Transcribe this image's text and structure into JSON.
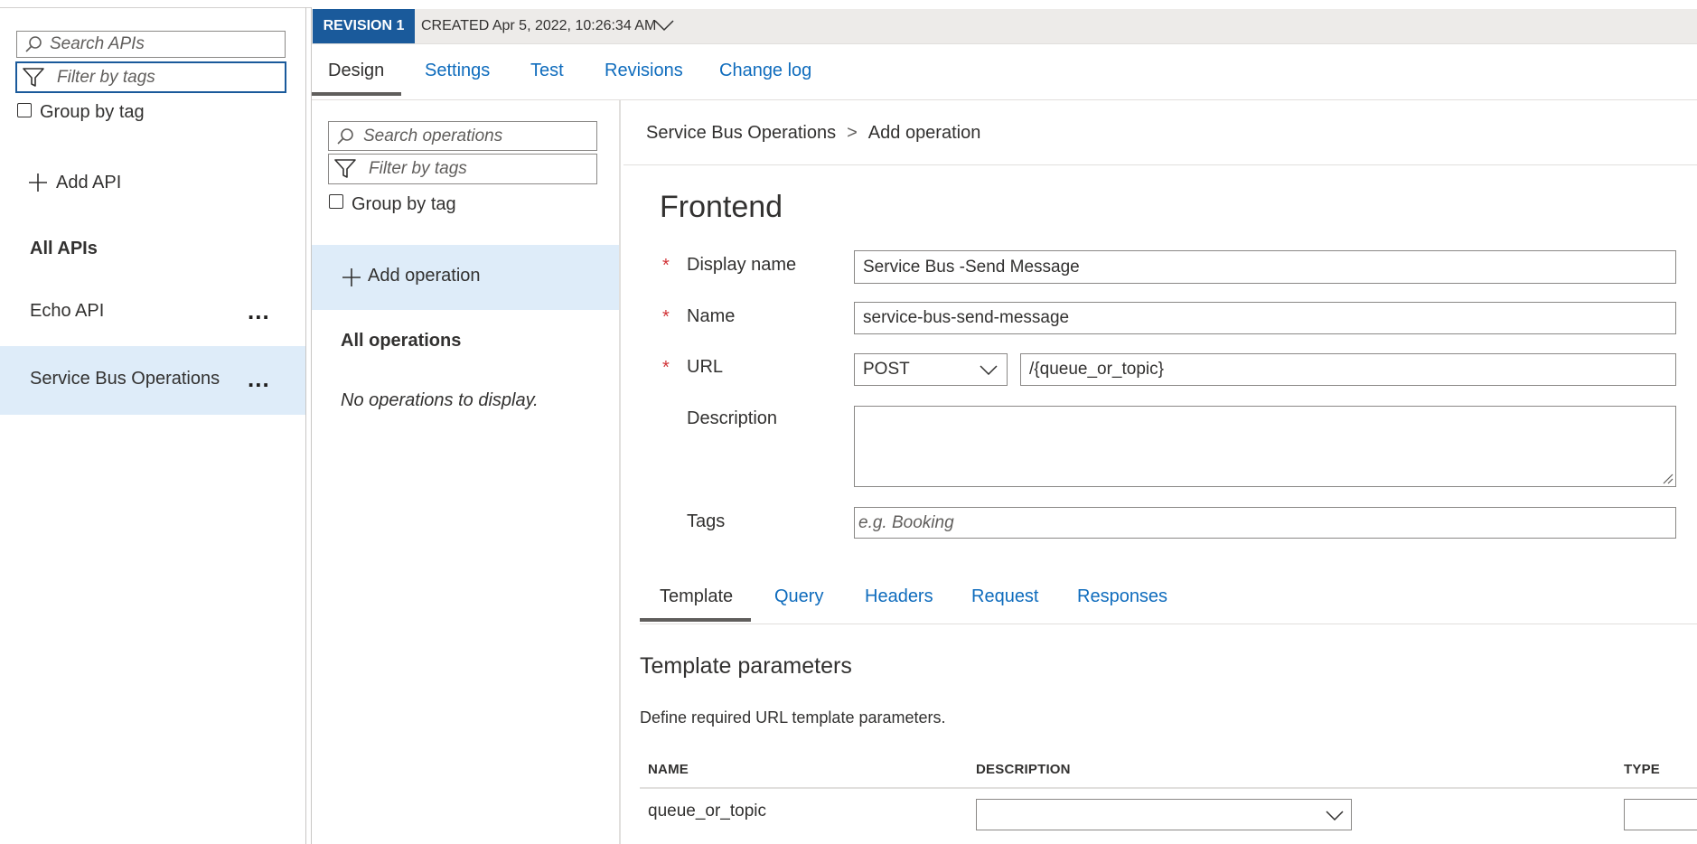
{
  "left": {
    "search_placeholder": "Search APIs",
    "filter_placeholder": "Filter by tags",
    "group_by_tag": "Group by tag",
    "add_api": "Add API",
    "all_apis": "All APIs",
    "apis": [
      {
        "label": "Echo API"
      },
      {
        "label": "Service Bus Operations"
      }
    ],
    "more": "..."
  },
  "revision": {
    "badge": "REVISION 1",
    "created": "CREATED Apr 5, 2022, 10:26:34 AM"
  },
  "tabs": [
    "Design",
    "Settings",
    "Test",
    "Revisions",
    "Change log"
  ],
  "operations": {
    "search_placeholder": "Search operations",
    "filter_placeholder": "Filter by tags",
    "group_by_tag": "Group by tag",
    "add_operation": "Add operation",
    "all_operations": "All operations",
    "empty": "No operations to display."
  },
  "breadcrumb": {
    "api": "Service Bus Operations",
    "separator": ">",
    "current": "Add operation"
  },
  "frontend": {
    "title": "Frontend",
    "required_mark": "*",
    "display_name_label": "Display name",
    "display_name_value": "Service Bus -Send Message",
    "name_label": "Name",
    "name_value": "service-bus-send-message",
    "url_label": "URL",
    "method": "POST",
    "url_value": "/{queue_or_topic}",
    "description_label": "Description",
    "description_value": "",
    "tags_label": "Tags",
    "tags_placeholder": "e.g. Booking"
  },
  "subtabs": [
    "Template",
    "Query",
    "Headers",
    "Request",
    "Responses"
  ],
  "template": {
    "title": "Template parameters",
    "description": "Define required URL template parameters.",
    "columns": [
      "NAME",
      "DESCRIPTION",
      "TYPE"
    ],
    "rows": [
      {
        "name": "queue_or_topic",
        "description": "",
        "type": ""
      }
    ]
  },
  "colors": {
    "accent": "#0f6cbd",
    "badge": "#1a5a9b",
    "selected": "#deecf9",
    "required": "#d13438"
  }
}
